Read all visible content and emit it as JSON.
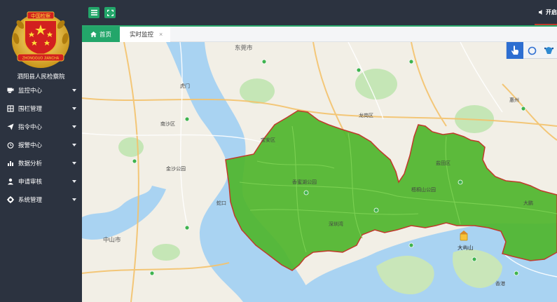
{
  "org": {
    "name": "泗阳县人民检察院",
    "emblem_text": "中国检察",
    "emblem_band": "ZHONGGUO JIANCHA"
  },
  "menu": [
    {
      "label": "监控中心",
      "icon": "monitor-icon"
    },
    {
      "label": "围栏管理",
      "icon": "fence-icon"
    },
    {
      "label": "指令中心",
      "icon": "send-icon"
    },
    {
      "label": "报警中心",
      "icon": "alarm-clock-icon"
    },
    {
      "label": "数据分析",
      "icon": "chart-icon"
    },
    {
      "label": "申请审核",
      "icon": "user-icon"
    },
    {
      "label": "系统管理",
      "icon": "gear-icon"
    }
  ],
  "topbar": {
    "right_label": "开启"
  },
  "tabs": {
    "home": "首页",
    "live": "实时监控",
    "close": "×"
  },
  "map": {
    "labels": {
      "dongguan": "东莞市",
      "zhongshan": "中山市",
      "shenzhenwan": "深圳湾",
      "nansha": "南沙区",
      "humen": "虎门",
      "jinsha": "金沙公园",
      "xiangmi": "香蜜湖公园",
      "wutong": "梧桐山公园",
      "yantian": "盐田区",
      "longgang": "龙岗区",
      "baoan": "宝安区",
      "huizhou": "惠州",
      "dapeng": "大鹏",
      "lantau": "大屿山",
      "hongkong": "香港",
      "shekou": "蛇口"
    },
    "colors": {
      "fence": "#4fb52d",
      "fence_border": "#c0392b",
      "land": "#f2efe6",
      "water": "#a9d3f2",
      "park": "#c5e6b6"
    }
  }
}
